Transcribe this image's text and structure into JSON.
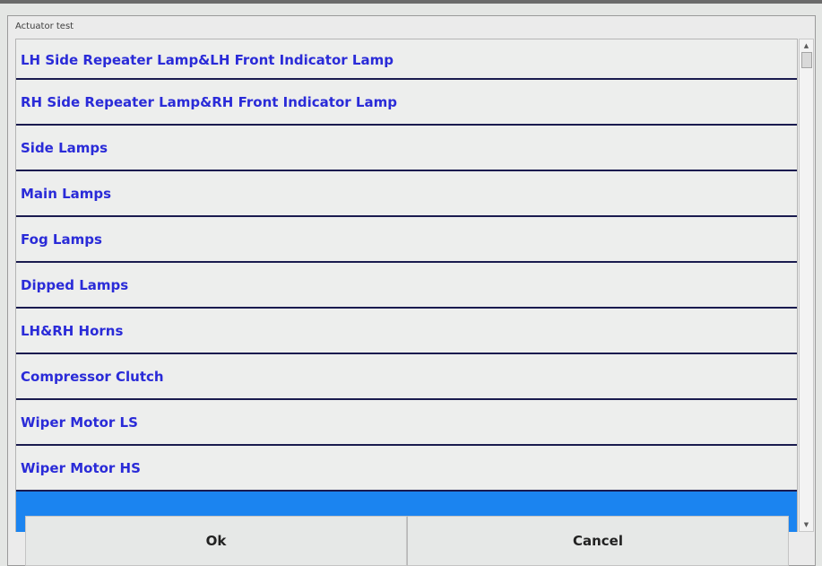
{
  "window": {
    "title": "Actuator test"
  },
  "list": {
    "items": [
      {
        "label": "LH Side Repeater Lamp&LH Front Indicator Lamp"
      },
      {
        "label": "RH Side Repeater Lamp&RH Front Indicator Lamp"
      },
      {
        "label": "Side Lamps"
      },
      {
        "label": "Main Lamps"
      },
      {
        "label": "Fog Lamps"
      },
      {
        "label": "Dipped Lamps"
      },
      {
        "label": "LH&RH Horns"
      },
      {
        "label": "Compressor Clutch"
      },
      {
        "label": "Wiper Motor LS"
      },
      {
        "label": "Wiper Motor HS"
      },
      {
        "label": ""
      }
    ],
    "selected_index": 10
  },
  "buttons": {
    "ok": "Ok",
    "cancel": "Cancel"
  },
  "colors": {
    "item_text": "#2a2bd8",
    "selected": "#1b84f0",
    "divider": "#1a1b4f"
  },
  "icons": {
    "scroll_up": "scroll-up-arrow-icon",
    "scroll_down": "scroll-down-arrow-icon"
  }
}
